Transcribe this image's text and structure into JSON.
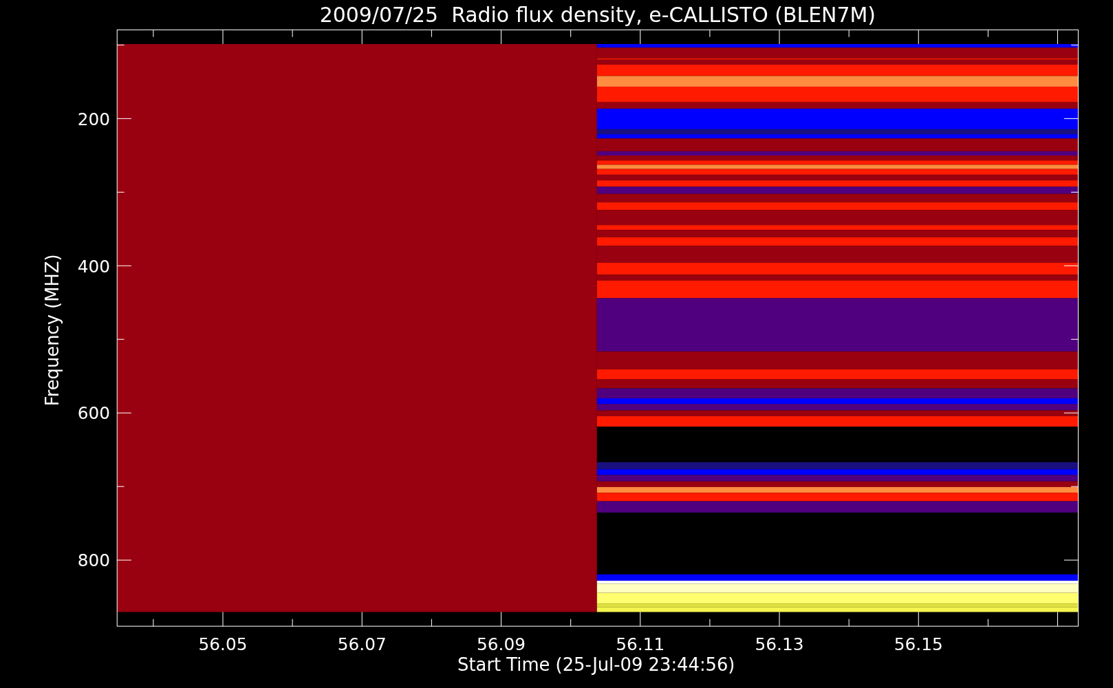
{
  "plot": {
    "title": "2009/07/25  Radio flux density, e-CALLISTO (BLEN7M)",
    "xlabel": "Start Time (25-Jul-09 23:44:56)",
    "ylabel": "Frequency (MHZ)",
    "xtick_labels": [
      "56.05",
      "56.07",
      "56.09",
      "56.11",
      "56.13",
      "56.15"
    ],
    "ytick_labels": [
      "200",
      "400",
      "600",
      "800"
    ]
  }
}
